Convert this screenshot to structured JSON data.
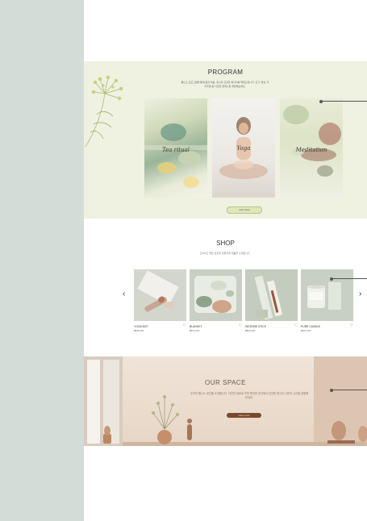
{
  "program": {
    "title": "PROGRAM",
    "description": "웰니스 프로그램을 통해 몸과 마음, 정신의 건강한 에너지를 깨워드립니다. 요가, 명상, 티 리추얼 등 다양한 클래스를 경험해보세요.",
    "cards": [
      {
        "label": "Tea ritual"
      },
      {
        "label": "Yoga"
      },
      {
        "label": "Meditation"
      }
    ],
    "button": "view more"
  },
  "shop": {
    "title": "SHOP",
    "description": "건강하고 좋은 습관을 만들어줄 제품을 소개합니다.",
    "products": [
      {
        "name": "YOGA MAT",
        "price": "₩48,000"
      },
      {
        "name": "BLANKET",
        "price": "₩72,000"
      },
      {
        "name": "INCENSE STICK",
        "price": "₩18,000"
      },
      {
        "name": "PURE CANDLE",
        "price": "₩24,000"
      }
    ],
    "prev_arrow": "‹",
    "next_arrow": "›",
    "heart_icon": "♡"
  },
  "space": {
    "title": "OUR SPACE",
    "description": "우리의 웰니스 공간을 소개합니다. 자연의 재료로 꾸민 편안한 공간에서 온전한 휴식과 나만의 시간을 경험해 보세요.",
    "button": "view more"
  },
  "colors": {
    "left_panel": "#d4dcd7",
    "program_bg": "#eff1e1",
    "accent_green": "#dfe6b8",
    "space_button": "#7a4a2e"
  }
}
